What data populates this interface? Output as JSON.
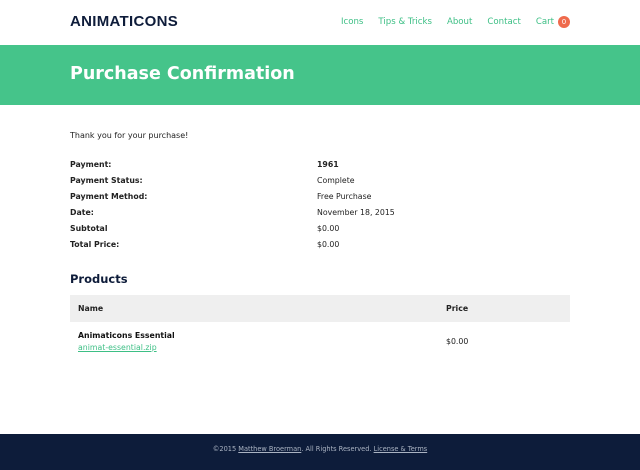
{
  "header": {
    "logo": "ANIMATICONS",
    "nav": [
      {
        "label": "Icons"
      },
      {
        "label": "Tips & Tricks"
      },
      {
        "label": "About"
      },
      {
        "label": "Contact"
      }
    ],
    "cart": {
      "label": "Cart",
      "count": "0"
    }
  },
  "banner": {
    "title": "Purchase Confirmation"
  },
  "thanks": "Thank you for your purchase!",
  "details": [
    {
      "label": "Payment:",
      "value": "1961"
    },
    {
      "label": "Payment Status:",
      "value": "Complete"
    },
    {
      "label": "Payment Method:",
      "value": "Free Purchase"
    },
    {
      "label": "Date:",
      "value": "November 18, 2015"
    },
    {
      "label": "Subtotal",
      "value": "$0.00"
    },
    {
      "label": "Total Price:",
      "value": "$0.00"
    }
  ],
  "products": {
    "title": "Products",
    "columns": {
      "name": "Name",
      "price": "Price"
    },
    "items": [
      {
        "name": "Animaticons Essential",
        "file": "animat-essential.zip",
        "price": "$0.00"
      }
    ]
  },
  "footer": {
    "copyright": "©2015",
    "author": "Matthew Broerman",
    "rights": ". All Rights Reserved.",
    "license": "License & Terms"
  },
  "colors": {
    "accent": "#45c48a",
    "navy": "#0d1c3a",
    "badge": "#ef6a4c"
  }
}
